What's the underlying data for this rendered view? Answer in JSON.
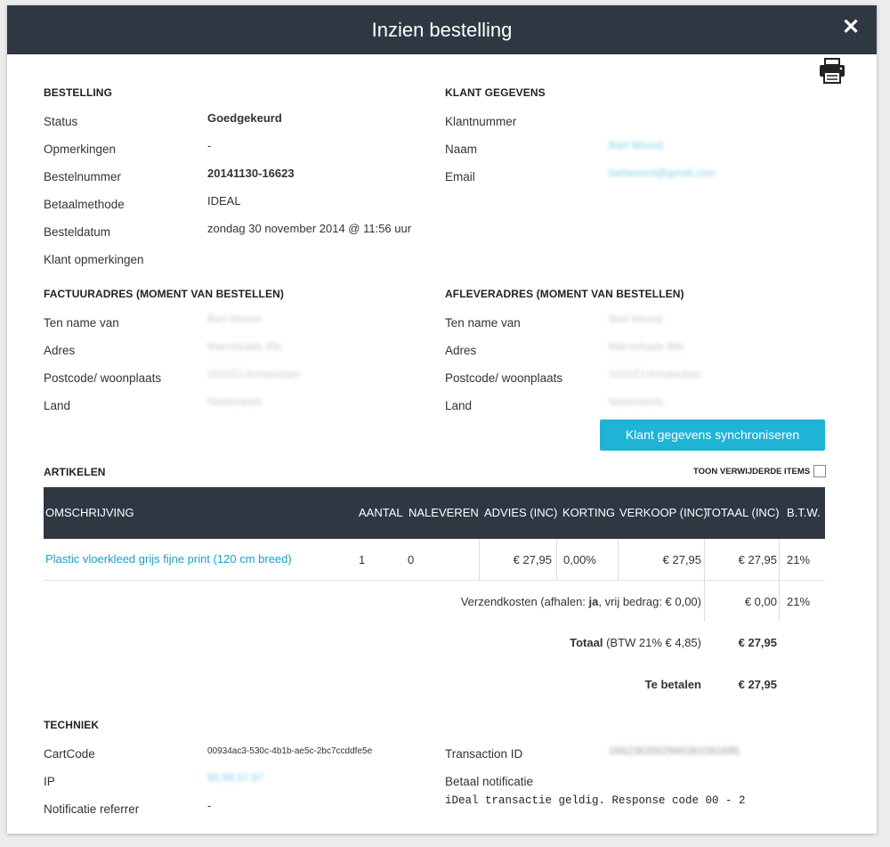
{
  "modal": {
    "title": "Inzien bestelling",
    "close_icon": "close-icon",
    "print_icon": "printer-icon"
  },
  "order": {
    "section_title": "BESTELLING",
    "status_label": "Status",
    "status_value": "Goedgekeurd",
    "remarks_label": "Opmerkingen",
    "remarks_value": "-",
    "number_label": "Bestelnummer",
    "number_value": "20141130-16623",
    "payment_label": "Betaalmethode",
    "payment_value": "IDEAL",
    "date_label": "Besteldatum",
    "date_value": "zondag 30 november 2014 @ 11:56 uur",
    "customer_remarks_label": "Klant opmerkingen"
  },
  "customer": {
    "section_title": "KLANT GEGEVENS",
    "number_label": "Klantnummer",
    "name_label": "Naam",
    "name_value": "Bart Woord",
    "email_label": "Email",
    "email_value": "bartwoord@gmail.com"
  },
  "billing": {
    "section_title": "FACTUURADRES (MOMENT VAN BESTELLEN)",
    "name_label": "Ten name van",
    "name_value": "Bart Woord",
    "address_label": "Adres",
    "address_value": "Marnixkade 89c",
    "postcode_label": "Postcode/ woonplaats",
    "postcode_value": "1015ZJ Amsterdam",
    "country_label": "Land",
    "country_value": "Nederlands"
  },
  "shipping": {
    "section_title": "AFLEVERADRES (MOMENT VAN BESTELLEN)",
    "name_label": "Ten name van",
    "name_value": "Bart Woord",
    "address_label": "Adres",
    "address_value": "Marnixkade 89c",
    "postcode_label": "Postcode/ woonplaats",
    "postcode_value": "1015ZJ Amsterdam",
    "country_label": "Land",
    "country_value": "Nederlands"
  },
  "sync_button": "Klant gegevens synchroniseren",
  "articles": {
    "section_title": "ARTIKELEN",
    "show_deleted_label": "TOON VERWIJDERDE ITEMS",
    "columns": [
      "OMSCHRIJVING",
      "AANTAL",
      "NALEVEREN",
      "ADVIES (INC)",
      "KORTING",
      "VERKOOP (INC)",
      "TOTAAL (INC)",
      "B.T.W."
    ],
    "row": {
      "description": "Plastic vloerkleed grijs fijne print (120 cm breed)",
      "quantity": "1",
      "backorder": "0",
      "advice": "€ 27,95",
      "discount": "0,00%",
      "sale": "€ 27,95",
      "total": "€ 27,95",
      "vat": "21%"
    },
    "shipping_row": {
      "label_prefix": "Verzendkosten (afhalen: ",
      "pickup_value": "ja",
      "label_suffix": ", vrij bedrag: € 0,00)",
      "total": "€ 0,00",
      "vat": "21%"
    },
    "totals": {
      "total_label": "Totaal",
      "total_note": " (BTW 21% € 4,85)",
      "total_value": "€ 27,95",
      "pay_label": "Te betalen",
      "pay_value": "€ 27,95"
    }
  },
  "tech": {
    "section_title": "TECHNIEK",
    "cartcode_label": "CartCode",
    "cartcode_value": "00934ac3-530c-4b1b-ae5c-2bc7ccddfe5e",
    "ip_label": "IP",
    "ip_value": "95.96.57.97",
    "referrer_label": "Notificatie referrer",
    "referrer_value": "-",
    "transaction_label": "Transaction ID",
    "transaction_value": "1662363552945381081695",
    "notification_label": "Betaal notificatie",
    "notification_value": "iDeal transactie geldig. Response code 00 - 2"
  }
}
